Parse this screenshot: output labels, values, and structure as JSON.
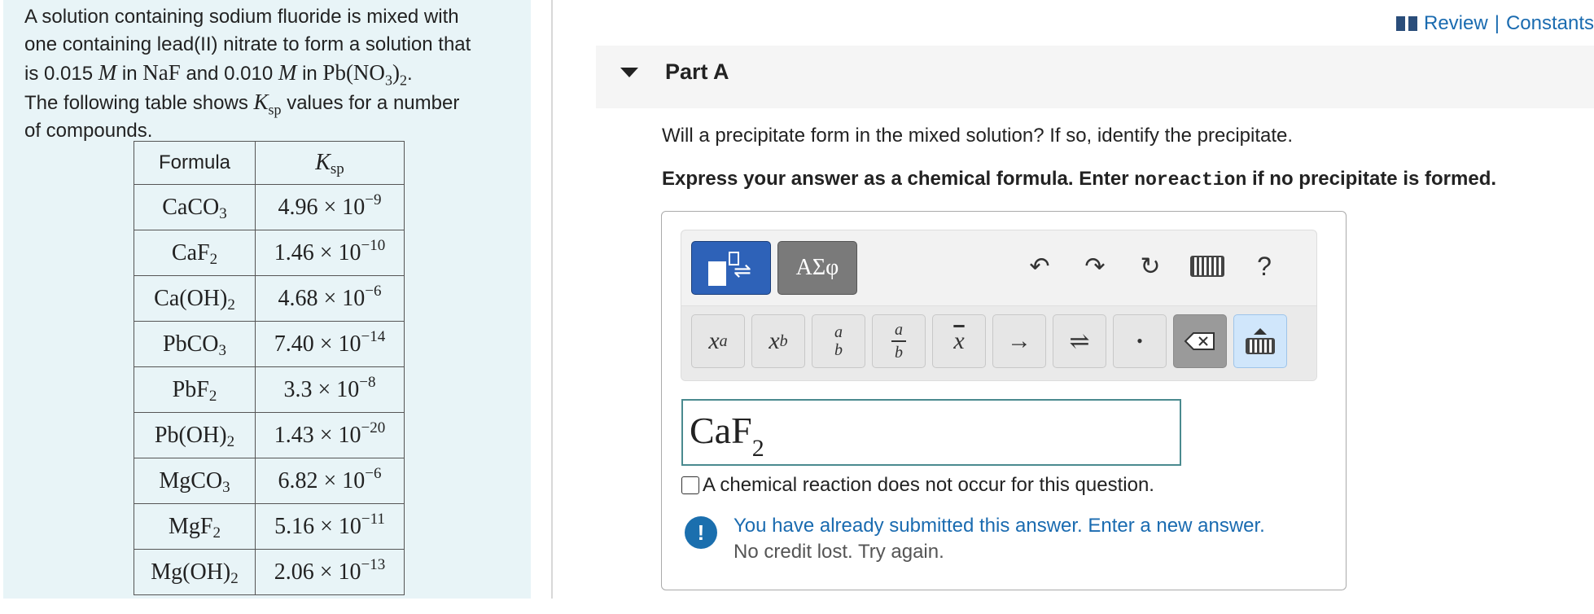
{
  "problem": {
    "line1": "A solution containing sodium fluoride is mixed with",
    "line2": "one containing lead(II) nitrate to form a solution that",
    "line3_pre": "is 0.015",
    "unit_M": "M",
    "line3_mid": "in",
    "naf": "NaF",
    "line3_and": "and 0.010",
    "line3_in": "in",
    "pbno3": "Pb(NO",
    "pbno3_sub": "3",
    "pbno3_close": ")",
    "pbno3_sub2": "2",
    "period": ".",
    "line4_pre": "The following table shows",
    "ksp_K": "K",
    "ksp_sub": "sp",
    "line4_post": "values for a number",
    "line5": "of compounds."
  },
  "ksp_table": {
    "header_formula": "Formula",
    "header_ksp_K": "K",
    "header_ksp_sub": "sp",
    "rows": [
      {
        "f_main": "CaCO",
        "f_sub": "3",
        "f_tail": "",
        "f_tail_sub": "",
        "mant": "4.96",
        "exp": "−9"
      },
      {
        "f_main": "CaF",
        "f_sub": "2",
        "f_tail": "",
        "f_tail_sub": "",
        "mant": "1.46",
        "exp": "−10"
      },
      {
        "f_main": "Ca(OH)",
        "f_sub": "2",
        "f_tail": "",
        "f_tail_sub": "",
        "mant": "4.68",
        "exp": "−6"
      },
      {
        "f_main": "PbCO",
        "f_sub": "3",
        "f_tail": "",
        "f_tail_sub": "",
        "mant": "7.40",
        "exp": "−14"
      },
      {
        "f_main": "PbF",
        "f_sub": "2",
        "f_tail": "",
        "f_tail_sub": "",
        "mant": "3.3",
        "exp": "−8"
      },
      {
        "f_main": "Pb(OH)",
        "f_sub": "2",
        "f_tail": "",
        "f_tail_sub": "",
        "mant": "1.43",
        "exp": "−20"
      },
      {
        "f_main": "MgCO",
        "f_sub": "3",
        "f_tail": "",
        "f_tail_sub": "",
        "mant": "6.82",
        "exp": "−6"
      },
      {
        "f_main": "MgF",
        "f_sub": "2",
        "f_tail": "",
        "f_tail_sub": "",
        "mant": "5.16",
        "exp": "−11"
      },
      {
        "f_main": "Mg(OH)",
        "f_sub": "2",
        "f_tail": "",
        "f_tail_sub": "",
        "mant": "2.06",
        "exp": "−13"
      }
    ],
    "times_ten": "× 10"
  },
  "header": {
    "review": "Review",
    "sep": "|",
    "constants": "Constants",
    "icon": "book-icon"
  },
  "part": {
    "title": "Part A"
  },
  "question": {
    "text": "Will a precipitate form in the mixed solution? If so, identify the precipitate.",
    "instr_pre": "Express your answer as a chemical formula. Enter",
    "instr_code": "noreaction",
    "instr_post": "if no precipitate is formed."
  },
  "toolbar": {
    "symbols_label": "ΑΣφ",
    "help_label": "?",
    "undo_icon": "↶",
    "redo_icon": "↷",
    "reset_icon": "↻",
    "keys": {
      "x": "x",
      "a": "a",
      "b": "b",
      "xbar": "x",
      "arrow": "→",
      "equilibrium": "⇌",
      "dot": "•"
    }
  },
  "answer": {
    "value_main": "CaF",
    "value_sub": "2",
    "no_reaction_label": "A chemical reaction does not occur for this question."
  },
  "feedback": {
    "icon": "!",
    "main": "You have already submitted this answer. Enter a new answer.",
    "sub": "No credit lost. Try again."
  }
}
